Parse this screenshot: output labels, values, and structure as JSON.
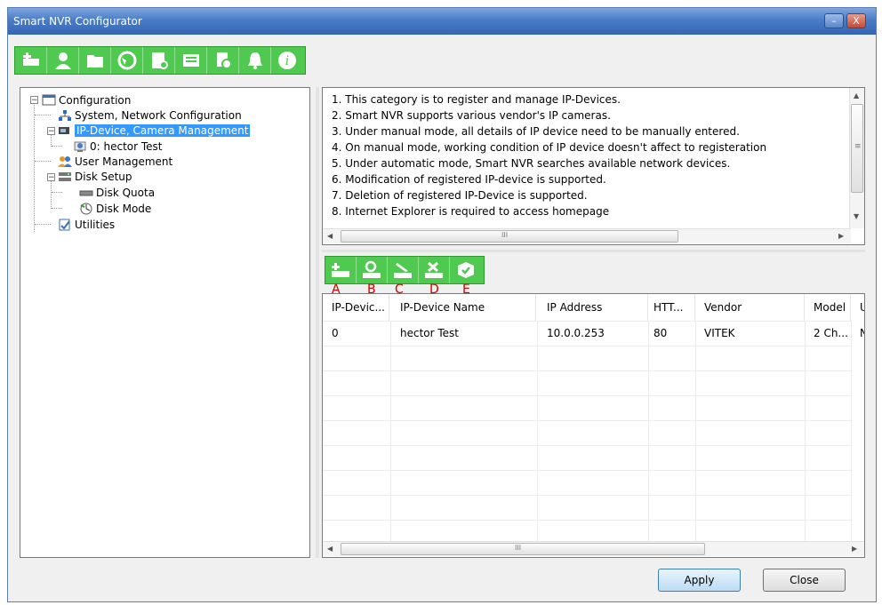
{
  "window": {
    "title": "Smart NVR Configurator",
    "minimize_glyph": "–",
    "close_glyph": "X"
  },
  "toolbar": {
    "icons": [
      "add-device-icon",
      "user-icon",
      "folder-icon",
      "network-icon",
      "disk-icon",
      "keyboard-icon",
      "device-info-icon",
      "bell-icon",
      "info-icon"
    ]
  },
  "tree": {
    "root": "Configuration",
    "items": [
      {
        "label": "System, Network Configuration",
        "icon": "network-config-icon"
      },
      {
        "label": "IP-Device, Camera Management",
        "icon": "camera-management-icon",
        "selected": true
      },
      {
        "label": "0: hector Test",
        "icon": "camera-icon"
      },
      {
        "label": "User Management",
        "icon": "users-icon"
      },
      {
        "label": "Disk Setup",
        "icon": "disk-setup-icon"
      },
      {
        "label": "Disk Quota",
        "icon": "disk-icon"
      },
      {
        "label": "Disk Mode",
        "icon": "disk-mode-icon"
      },
      {
        "label": "Utilities",
        "icon": "utilities-icon"
      }
    ]
  },
  "info_lines": [
    "1. This category is to register and manage IP-Devices.",
    "2. Smart NVR supports various vendor's IP cameras.",
    "3. Under manual mode, all details of IP device need to be manually entered.",
    "4. On manual mode, working condition of IP device doesn't affect to registeration",
    "5. Under automatic mode, Smart NVR searches available network devices.",
    "6. Modification of registered IP-device is supported.",
    "7. Deletion of registered IP-Device is supported.",
    "8. Internet Explorer is required to access homepage"
  ],
  "scroll_glyphs": {
    "up": "▲",
    "down": "▼",
    "left": "◀",
    "right": "▶",
    "grip": "≡",
    "hgrip": "III"
  },
  "device_toolbar": {
    "icons": [
      "add-ip-device-icon",
      "search-device-icon",
      "modify-device-icon",
      "delete-device-icon",
      "apply-device-icon"
    ],
    "letters": [
      "A",
      "B",
      "C",
      "D",
      "E"
    ],
    "letter_color": "#cc0000"
  },
  "grid": {
    "columns": [
      "IP-Devic...",
      "IP-Device Name",
      "IP Address",
      "HTT...",
      "Vendor",
      "Model",
      "UA"
    ],
    "rows": [
      [
        "0",
        "hector Test",
        "10.0.0.253",
        "80",
        "VITEK",
        "2 Ch...",
        "No"
      ]
    ]
  },
  "buttons": {
    "apply": "Apply",
    "close": "Close"
  },
  "colors": {
    "titlebar": "#4a7cc7",
    "toolbar_green": "#4fc94f",
    "selection": "#3399ff"
  }
}
